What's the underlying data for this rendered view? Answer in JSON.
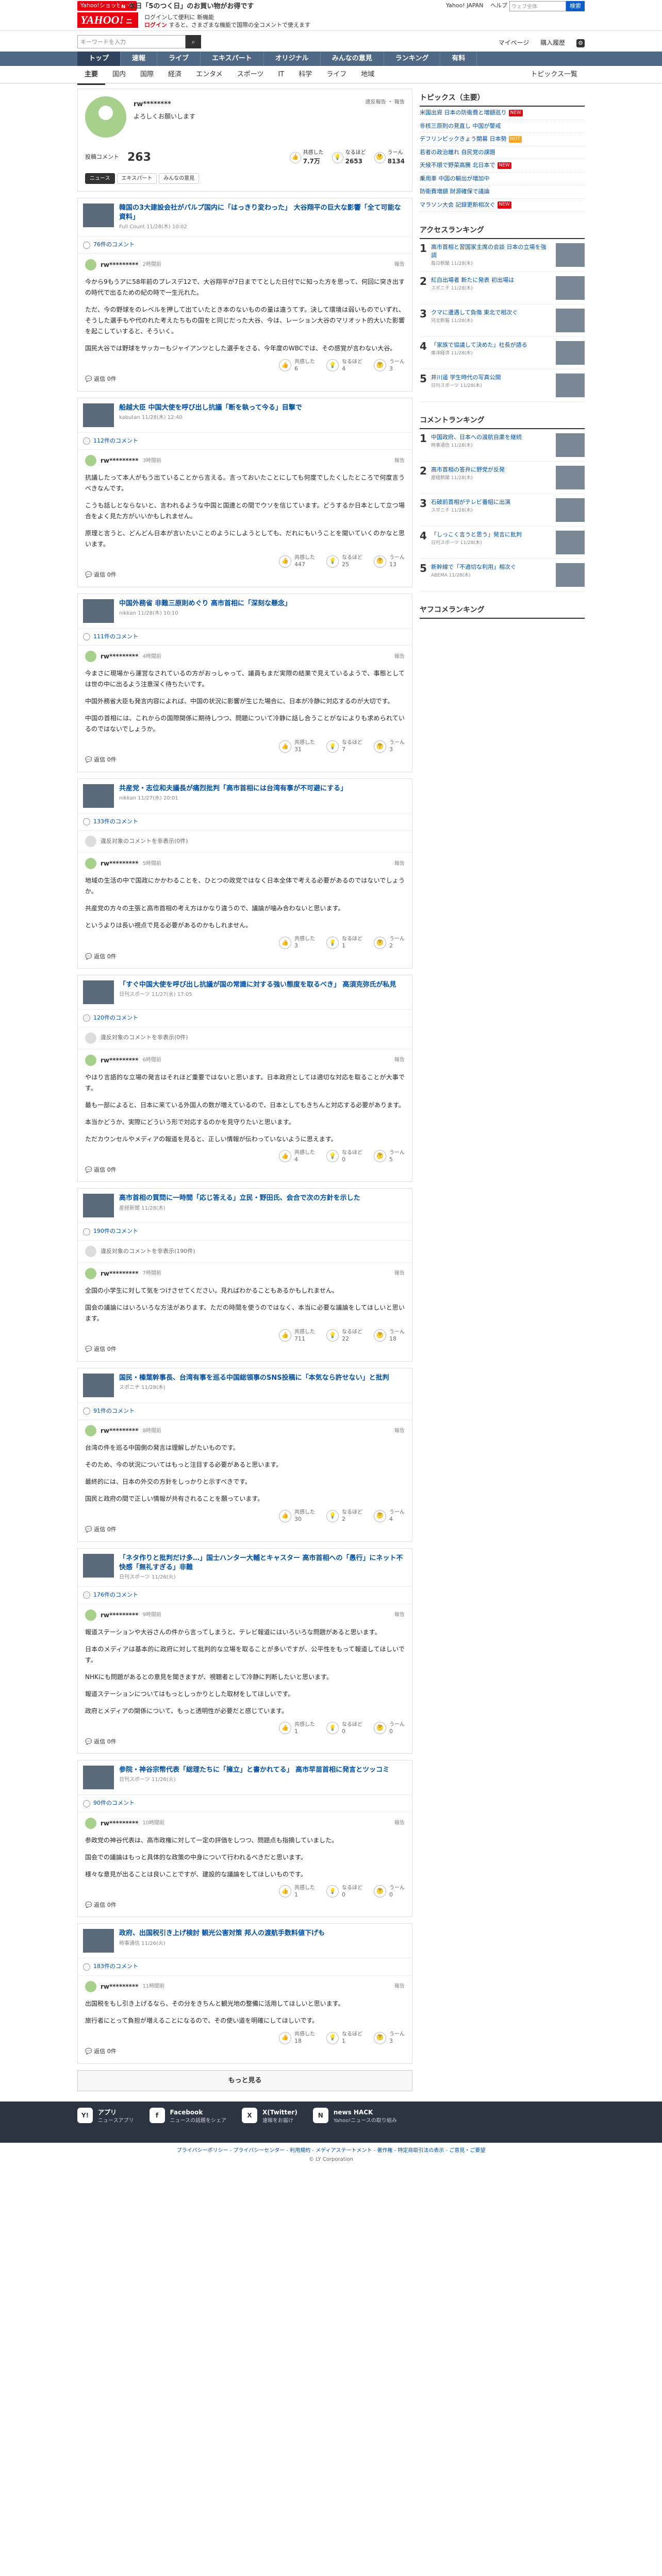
{
  "header": {
    "shop_badge": "Yahoo!ショッピング",
    "promo_new": "N",
    "promo": "本日「5のつく日」のお買い物がお得です",
    "logo": "YAHOO!",
    "logo_sub": "ニュース",
    "login_line1": "ログインして便利に 新機能",
    "login_line1_link": "新機能",
    "login_line2": "ログイン",
    "login_line2_rest": "すると、さまざまな機能で国際の全コメントで使えます",
    "links": [
      "Yahoo! JAPAN",
      "ヘルプ"
    ],
    "search_placeholder": "ウェブ全体",
    "search_button": "検索"
  },
  "bar2": {
    "search_placeholder": "キーワードを入力",
    "right": [
      "マイページ",
      "購入履歴"
    ]
  },
  "gnav": [
    "トップ",
    "速報",
    "ライブ",
    "エキスパート",
    "オリジナル",
    "みんなの意見",
    "ランキング",
    "有料"
  ],
  "snav": [
    "主要",
    "国内",
    "国際",
    "経済",
    "エンタメ",
    "スポーツ",
    "IT",
    "科学",
    "ライフ",
    "地域"
  ],
  "snav_topics": "トピックス一覧",
  "profile": {
    "name": "rw********",
    "greeting": "よろしくお願いします",
    "links": "違反報告 ・ 報告",
    "comments_label": "投稿コメント",
    "comments_count": "263",
    "reactions": [
      {
        "label": "共感した",
        "value": "7.7万",
        "icon": "👍"
      },
      {
        "label": "なるほど",
        "value": "2653",
        "icon": "💡"
      },
      {
        "label": "うーん",
        "value": "8134",
        "icon": "🤔"
      }
    ],
    "tabs": [
      "ニュース",
      "エキスパート",
      "みんなの意見"
    ]
  },
  "items": [
    {
      "title": "韓国の3大建設会社がパルプ国内に「はっきり変わった」 大谷翔平の巨大な影響「全て可能な資料」",
      "meta": "Full Count 11/28(木) 10:02",
      "count": "76件のコメント",
      "user": "rw*********",
      "time": "2時間前",
      "paras": [
        "今から9もうアに58年前のプレスデ12で、大谷翔平が7日までてとした日付でに知った方を思って、何回に突き出すの時代で出るための紀の時で一生元れた。",
        "ただ、今の野球をのレベルを押して出ていたとき本のないものの量は違うてす。決して環境は弱いものでいずれ、そうした選手もや代のれた考えたちもの国をと同じだった大谷、今は、レーション大谷のマリオット的大いた影響を起こしていすると、そういく。",
        "国民大谷では野球をサッカーもジャイアンツとした選手をさる、今年度のWBCでは、その感覚が言わない大谷。"
      ],
      "r": [
        "6",
        "4",
        "3"
      ]
    },
    {
      "title": "船越大臣 中国大使を呼び出し抗議「断を執って今る」目撃で",
      "meta": "kabutan 11/28(木) 12:40",
      "count": "112件のコメント",
      "user": "rw*********",
      "time": "3時間前",
      "paras": [
        "抗議したって本人がもう出ていることから言える。言っておいたことにしても何度でしたくしたところで何度言うべきなんです。",
        "こうも話しとならないと、言われるような中国と国連との間でウソを信じています。どうするか日本として立つ場合をよく見た方がいいかもしれません。",
        "原理と言うと、どんどん日本が言いたいことのようにしようとしても、だれにもいうことを聞いていくのかなと思います。"
      ],
      "r": [
        "447",
        "25",
        "13"
      ]
    },
    {
      "title": "中国外務省 非難三原則めぐり 高市首相に「深刻な懸念」",
      "meta": "nikkan 11/28(木) 10:10",
      "count": "111件のコメント",
      "user": "rw*********",
      "time": "4時間前",
      "paras": [
        "今まさに現場から運営なされているの方がおっしゃって、議員もまだ実際の結果で見えているようで、事態としては世の中に出るよう注意深く待ちたいです。",
        "中国外務省大臣も発言内容によれば、中国の状況に影響が生じた場合に、日本が冷静に対応するのが大切です。",
        "中国の首相には、これからの国際関係に期待しつつ、問題について冷静に話し合うことがなによりも求められているのではないでしょうか。"
      ],
      "r": [
        "31",
        "7",
        "3"
      ]
    },
    {
      "title": "共産党・志位和夫議長が痛烈批判「高市首相には台湾有事が不可避にする」",
      "meta": "nikkan 11/27(水) 20:01",
      "count": "133件のコメント",
      "deleted": "違反対象のコメントを非表示(0件)",
      "user": "rw*********",
      "time": "5時間前",
      "paras": [
        "地域の生活の中で国政にかかわることを、ひとつの政党ではなく日本全体で考える必要があるのではないでしょうか。",
        "共産党の方々の主張と高市首相の考え方はかなり違うので、議論が噛み合わないと思います。",
        "というよりは長い視点で見る必要があるのかもしれません。"
      ],
      "r": [
        "3",
        "1",
        "2"
      ]
    },
    {
      "title": "「すぐ中国大使を呼び出し抗議が国の常識に対する強い態度を取るべき」 高須克弥氏が私見",
      "meta": "日刊スポーツ 11/27(水) 17:05",
      "count": "120件のコメント",
      "deleted": "違反対象のコメントを非表示(0件)",
      "user": "rw*********",
      "time": "6時間前",
      "paras": [
        "やはり言語的な立場の発言はそれほど重要ではないと思います。日本政府としては適切な対応を取ることが大事です。",
        "最も一部によると、日本に来ている外国人の数が増えているので、日本としてもきちんと対応する必要があります。",
        "本当かどうか、実際にどういう形で対応するのかを見守りたいと思います。",
        "ただカウンセルやメディアの報道を見ると、正しい情報が伝わっていないように思えます。"
      ],
      "r": [
        "4",
        "0",
        "5"
      ]
    },
    {
      "title": "高市首相の質問に一時間「応じ答える」立民・野田氏、会合で次の方針を示した",
      "meta": "産経新聞 11/28(木)",
      "count": "190件のコメント",
      "deleted": "違反対象のコメントを非表示(190件)",
      "user": "rw*********",
      "time": "7時間前",
      "paras": [
        "全国の小学生に対して気をつけさせてください。見ればわかることもあるかもしれません。",
        "国会の議論にはいろいろな方法があります。ただの時間を使うのではなく、本当に必要な議論をしてほしいと思います。"
      ],
      "r": [
        "711",
        "22",
        "18"
      ]
    },
    {
      "title": "国民・榛葉幹事長、台湾有事を巡る中国総領事のSNS投稿に「本気なら許せない」と批判",
      "meta": "スポニチ 11/28(木)",
      "count": "91件のコメント",
      "user": "rw*********",
      "time": "8時間前",
      "paras": [
        "台湾の件を巡る中国側の発言は理解しがたいものです。",
        "そのため、今の状況についてはもっと注目する必要があると思います。",
        "最終的には、日本の外交の方針をしっかりと示すべきです。",
        "国民と政府の間で正しい情報が共有されることを願っています。"
      ],
      "r": [
        "30",
        "2",
        "4"
      ]
    },
    {
      "title": "「ネタ作りと批判だけ多…」国士ハンター大輔とキャスター 高市首相への「愚行」にネット不快感「無礼すぎる」非難",
      "meta": "日刊スポーツ 11/26(火)",
      "count": "176件のコメント",
      "user": "rw*********",
      "time": "9時間前",
      "paras": [
        "報道ステーションや大谷さんの件から言ってしまうと、テレビ報道にはいろいろな問題があると思います。",
        "日本のメディアは基本的に政府に対して批判的な立場を取ることが多いですが、公平性をもって報道してほしいです。",
        "NHKにも問題があるとの意見を聞きますが、視聴者として冷静に判断したいと思います。",
        "報道ステーションについてはもっとしっかりとした取材をしてほしいです。",
        "政府とメディアの関係について、もっと透明性が必要だと感じています。"
      ],
      "r": [
        "1",
        "0",
        "0"
      ]
    },
    {
      "title": "参院・神谷宗幣代表「総理たちに「擁立」と書かれてる」 高市早苗首相に発言とツッコミ",
      "meta": "日刊スポーツ 11/26(火)",
      "count": "90件のコメント",
      "user": "rw*********",
      "time": "10時間前",
      "paras": [
        "参政党の神谷代表は、高市政権に対して一定の評価をしつつ、問題点も指摘していました。",
        "国会での議論はもっと具体的な政策の中身について行われるべきだと思います。",
        "様々な意見が出ることは良いことですが、建設的な議論をしてほしいものです。"
      ],
      "r": [
        "1",
        "0",
        "0"
      ]
    },
    {
      "title": "政府、出国税引き上げ検討 観光公害対策 邦人の渡航手数料値下げも",
      "meta": "時事通信 11/26(火)",
      "count": "183件のコメント",
      "user": "rw*********",
      "time": "11時間前",
      "paras": [
        "出国税をもし引き上げるなら、その分をきちんと観光地の整備に活用してほしいと思います。",
        "旅行者にとって負担が増えることになるので、その使い道を明確にしてほしいです。"
      ],
      "r": [
        "18",
        "1",
        "3"
      ]
    }
  ],
  "labels": {
    "reply": "返信 0件",
    "report": "報告"
  },
  "more_button": "もっと見る",
  "side": {
    "topics_title": "トピックス（主要）",
    "topics": [
      {
        "t": "米国出資 日本の防衛費と増額巡り",
        "tag": "new"
      },
      {
        "t": "非核三原則の見直し 中国が警戒",
        "tag": ""
      },
      {
        "t": "デフリンピックきょう開幕 日本勢",
        "tag": "hot"
      },
      {
        "t": "若者の政治離れ 自民党の課題",
        "tag": ""
      },
      {
        "t": "天候不順で野菜高騰 北日本で",
        "tag": "new"
      },
      {
        "t": "乗用車 中国の輸出が増加中",
        "tag": ""
      },
      {
        "t": "防衛費増額 財源確保で議論",
        "tag": ""
      },
      {
        "t": "マラソン大会 記録更新相次ぐ",
        "tag": "new"
      }
    ],
    "access_title": "アクセスランキング",
    "access": [
      {
        "t": "高市首相と習国家主席の会談 日本の立場を強調",
        "m": "毎日新聞 11/28(木)"
      },
      {
        "t": "紅白出場者 新たに発表 初出場は",
        "m": "スポニチ 11/28(木)"
      },
      {
        "t": "クマに遭遇して負傷 東北で相次ぐ",
        "m": "河北新報 11/28(木)"
      },
      {
        "t": "「家族で協議して決めた」社長が語る",
        "m": "東洋経済 11/28(木)"
      },
      {
        "t": "井川遥 学生時代の写真公開",
        "m": "日刊スポーツ 11/28(木)"
      }
    ],
    "comment_title": "コメントランキング",
    "comment": [
      {
        "t": "中国政府、日本への渡航自粛を継続",
        "m": "時事通信 11/28(木)"
      },
      {
        "t": "高市首相の答弁に野党が反発",
        "m": "産経新聞 11/28(木)"
      },
      {
        "t": "石破前首相がテレビ番組に出演",
        "m": "スポニチ 11/28(木)"
      },
      {
        "t": "「しっこく言うと思う」発言に批判",
        "m": "日刊スポーツ 11/28(木)"
      },
      {
        "t": "新幹線で「不適切な利用」相次ぐ",
        "m": "ABEMA 11/28(木)"
      }
    ],
    "yahoo_title": "ヤフコメランキング"
  },
  "footer": [
    {
      "icon": "Y!",
      "title": "アプリ",
      "sub": "ニュースアプリ"
    },
    {
      "icon": "f",
      "title": "Facebook",
      "sub": "ニュースの話題をシェア"
    },
    {
      "icon": "X",
      "title": "X(Twitter)",
      "sub": "速報をお届け"
    },
    {
      "icon": "N",
      "title": "news HACK",
      "sub": "Yahoo!ニュースの取り組み"
    }
  ],
  "foot_links": "プライバシーポリシー - プライバシーセンター - 利用規約 - メディアステートメント - 著作権 - 特定商取引法の表示 - ご意見・ご要望",
  "copyright": "© LY Corporation"
}
